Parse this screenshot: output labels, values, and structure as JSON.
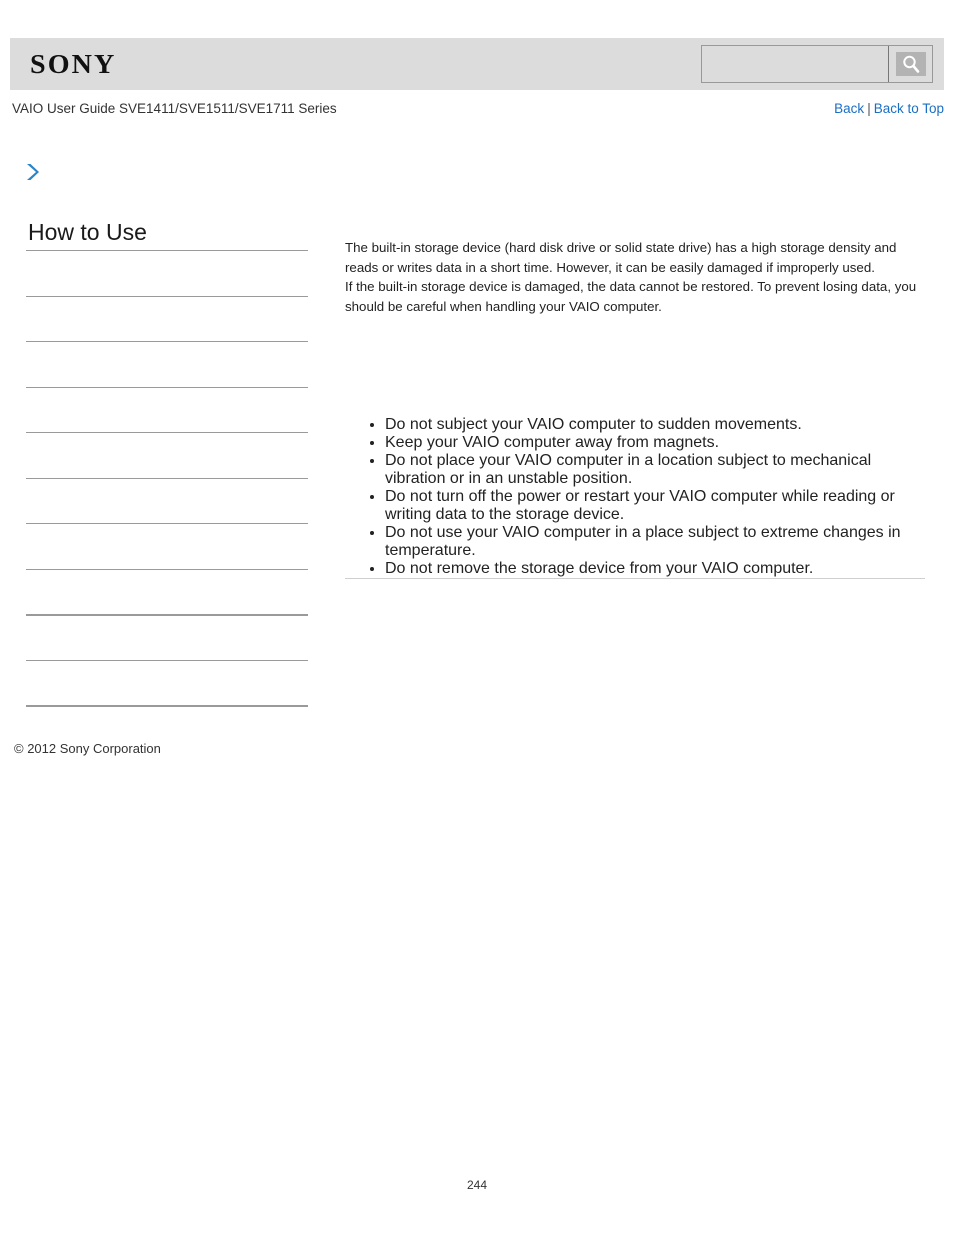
{
  "header": {
    "logo_text": "SONY",
    "search": {
      "value": "",
      "placeholder": "",
      "button_icon": "search-icon"
    }
  },
  "subheader": {
    "guide_title": "VAIO User Guide SVE1411/SVE1511/SVE1711 Series",
    "links": {
      "back": "Back",
      "separator": "|",
      "back_to_top": "Back to Top"
    }
  },
  "sidebar": {
    "breadcrumb_icon": "chevron-right-icon",
    "title": "How to Use",
    "items": [
      {
        "label": "",
        "thick": false
      },
      {
        "label": "",
        "thick": false
      },
      {
        "label": "",
        "thick": false
      },
      {
        "label": "",
        "thick": false
      },
      {
        "label": "",
        "thick": false
      },
      {
        "label": "",
        "thick": false
      },
      {
        "label": "",
        "thick": false
      },
      {
        "label": "",
        "thick": false
      },
      {
        "label": "",
        "thick": true
      },
      {
        "label": "",
        "thick": false
      },
      {
        "label": "",
        "thick": true
      }
    ],
    "copyright": "© 2012 Sony Corporation"
  },
  "main": {
    "paragraphs": [
      "The built-in storage device (hard disk drive or solid state drive) has a high storage density and reads or writes data in a short time. However, it can be easily damaged if improperly used.",
      "If the built-in storage device is damaged, the data cannot be restored. To prevent losing data, you should be careful when handling your VAIO computer."
    ],
    "bullets": [
      "Do not subject your VAIO computer to sudden movements.",
      "Keep your VAIO computer away from magnets.",
      "Do not place your VAIO computer in a location subject to mechanical vibration or in an unstable position.",
      "Do not turn off the power or restart your VAIO computer while reading or writing data to the storage device.",
      "Do not use your VAIO computer in a place subject to extreme changes in temperature.",
      "Do not remove the storage device from your VAIO computer."
    ]
  },
  "footer": {
    "page_number": "244"
  },
  "colors": {
    "header_bg": "#dcdcdc",
    "link": "#1a6fc4",
    "chevron": "#2b84c8",
    "rule": "#9a9a9a"
  }
}
